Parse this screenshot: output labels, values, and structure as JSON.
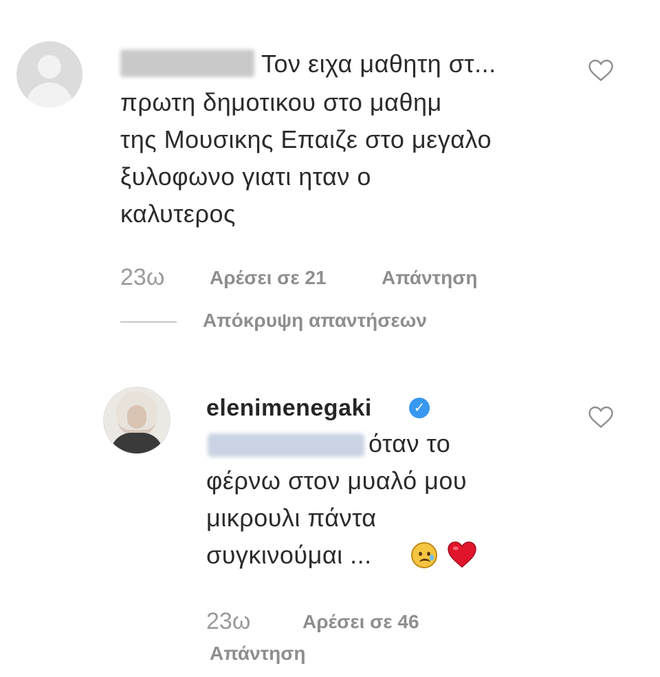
{
  "comment": {
    "text_lines": [
      "Τον ειχα μαθητη στ...",
      "πρωτη δημοτικου στο μαθημ",
      "της Μουσικης Επαιζε στο μεγαλο",
      "ξυλοφωνο γιατι ηταν ο",
      "καλυτερος"
    ],
    "time": "23ω",
    "likes_label": "Αρέσει σε 21",
    "reply_label": "Απάντηση",
    "hide_replies_label": "Απόκρυψη απαντήσεων"
  },
  "reply": {
    "username": "elenimenegaki",
    "verified_glyph": "✓",
    "text_lines": [
      "όταν το",
      "φέρνω στον μυαλό μου",
      "μικρουλι πάντα",
      "συγκινούμαι ..."
    ],
    "time": "23ω",
    "likes_label": "Αρέσει σε 46",
    "reply_label": "Απάντηση"
  },
  "colors": {
    "verified": "#3897f0",
    "heart_emoji": "#e0152b",
    "meta_text": "#8e8e8e"
  }
}
